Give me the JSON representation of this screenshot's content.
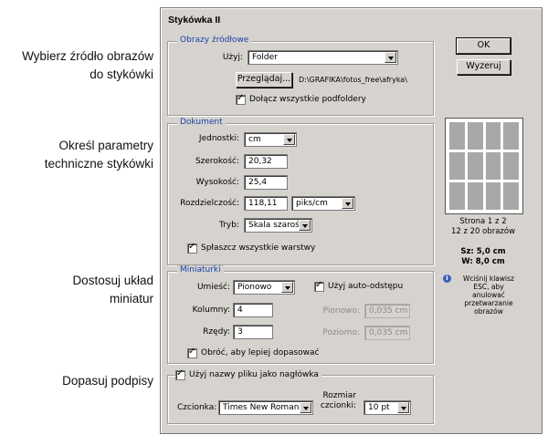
{
  "callouts": {
    "source": [
      "Wybierz źródło obrazów",
      "do stykówki"
    ],
    "document": [
      "Określ parametry",
      "techniczne stykówki"
    ],
    "layout": [
      "Dostosuj układ",
      "miniatur"
    ],
    "captions": "Dopasuj podpisy"
  },
  "dialog": {
    "title": "Stykówka II",
    "ok_label": "OK",
    "reset_label": "Wyzeruj"
  },
  "source": {
    "legend": "Obrazy źródłowe",
    "use_label": "Użyj:",
    "use_value": "Folder",
    "browse_label": "Przeglądaj...",
    "path": "D:\\GRAFIKA\\fotos_free\\afryka\\",
    "include_subfolders_label": "Dołącz wszystkie podfoldery",
    "include_subfolders": true
  },
  "document": {
    "legend": "Dokument",
    "units_label": "Jednostki:",
    "units_value": "cm",
    "width_label": "Szerokość:",
    "width_value": "20,32",
    "height_label": "Wysokość:",
    "height_value": "25,4",
    "resolution_label": "Rozdzielczość:",
    "resolution_value": "118,11",
    "resolution_unit": "piks/cm",
    "mode_label": "Tryb:",
    "mode_value": "Skala szarości",
    "flatten_label": "Spłaszcz wszystkie warstwy",
    "flatten": true
  },
  "thumbnails": {
    "legend": "Miniaturki",
    "place_label": "Umieść:",
    "place_value": "Pionowo",
    "columns_label": "Kolumny:",
    "columns_value": "4",
    "rows_label": "Rzędy:",
    "rows_value": "3",
    "auto_spacing_label": "Użyj auto-odstępu",
    "auto_spacing": true,
    "vertical_label": "Pionowo:",
    "vertical_value": "0,035 cm",
    "horizontal_label": "Poziomo:",
    "horizontal_value": "0,035 cm",
    "rotate_label": "Obróć, aby lepiej dopasować",
    "rotate": true
  },
  "captions": {
    "use_filename_label": "Użyj nazwy pliku jako nagłówka",
    "use_filename": true,
    "font_label": "Czcionka:",
    "font_value": "Times New Roman",
    "font_size_label_1": "Rozmiar",
    "font_size_label_2": "czcionki:",
    "font_size_value": "10 pt"
  },
  "preview": {
    "page": "Strona 1 z 2",
    "count": "12 z 20 obrazów",
    "width": "Sz: 5,0 cm",
    "height": "W: 8,0 cm",
    "thumb_color": "#a8a8a8",
    "tip": [
      "Wciśnij klawisz",
      "ESC, aby",
      "anulować",
      "przetwarzanie",
      "obrazów"
    ]
  }
}
